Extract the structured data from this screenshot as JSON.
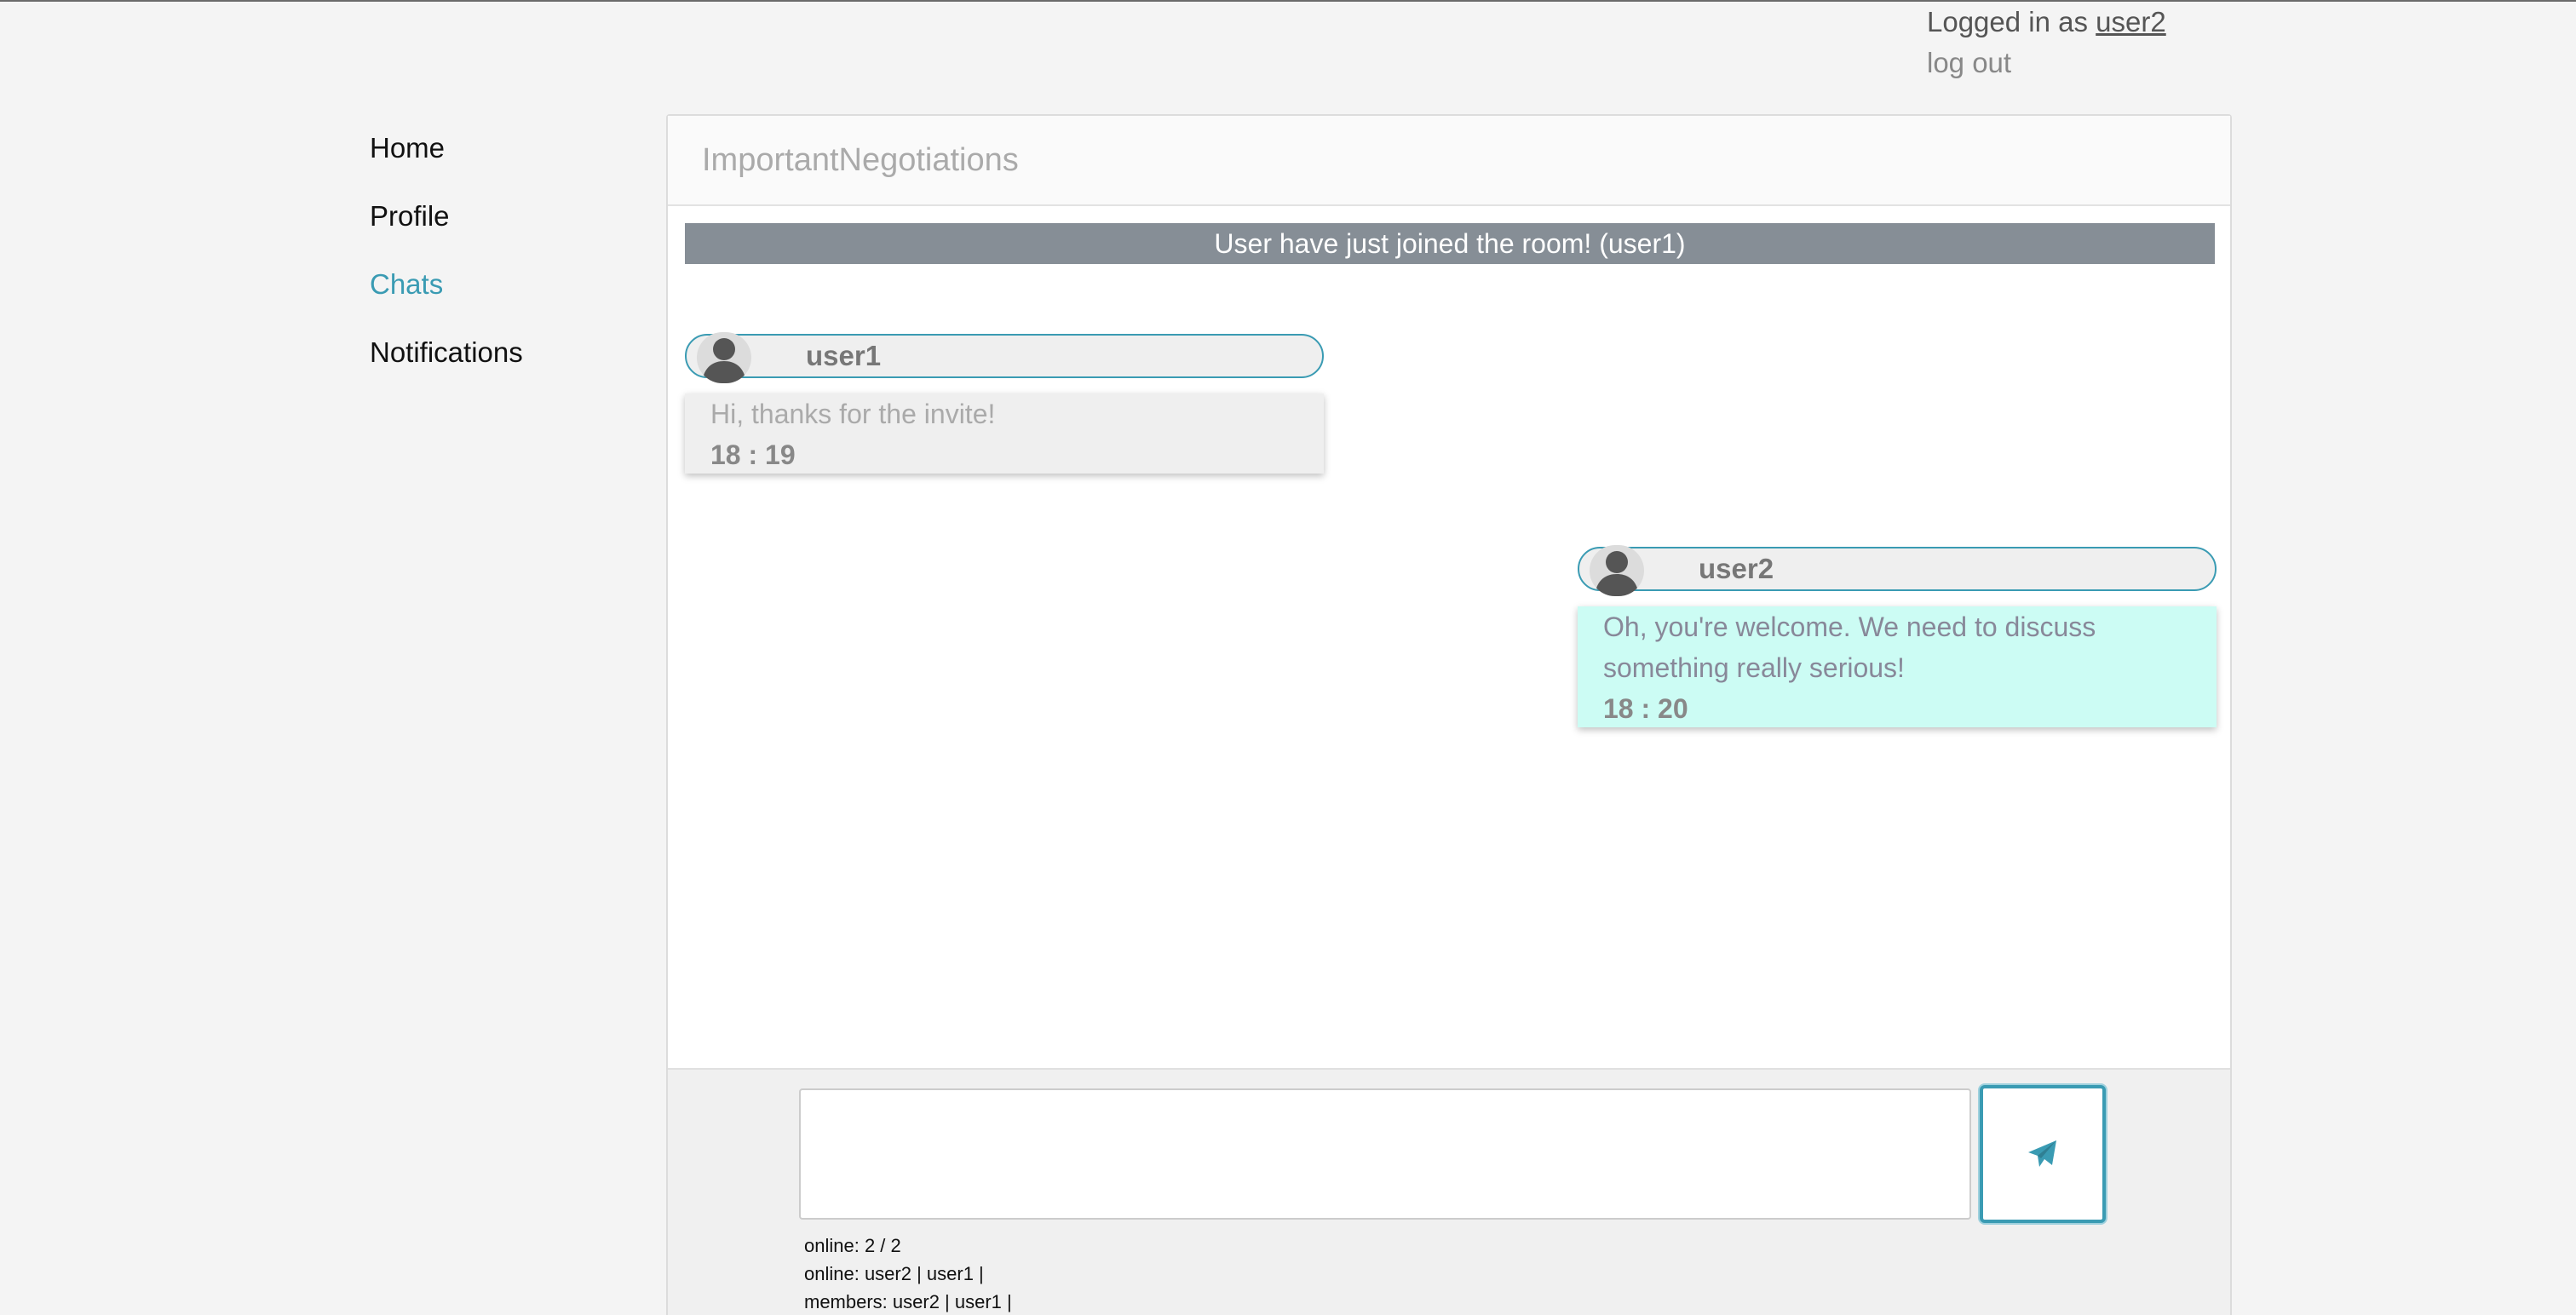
{
  "header": {
    "logged_in_prefix": "Logged in as",
    "username": "user2",
    "logout_label": "log out"
  },
  "sidebar": {
    "items": [
      {
        "label": "Home"
      },
      {
        "label": "Profile"
      },
      {
        "label": "Chats"
      },
      {
        "label": "Notifications"
      }
    ],
    "active": "Chats"
  },
  "chat": {
    "room_name": "ImportantNegotiations",
    "system_message": "User have just joined the room! (user1)",
    "messages": [
      {
        "author": "user1",
        "text": "Hi, thanks for the invite!",
        "time": "18 : 19"
      },
      {
        "author": "user2",
        "text": "Oh, you're welcome. We need to discuss something really serious!",
        "time": "18 : 20"
      }
    ]
  },
  "composer": {
    "message_value": "",
    "placeholder": "",
    "send_icon": "paper-plane-icon"
  },
  "status": {
    "online_count": "online: 2 / 2",
    "online_users": "online: user2 | user1 |",
    "members": "members: user2 | user1 |"
  },
  "colors": {
    "accent": "#3a9bb3",
    "system_bar": "#868e96",
    "own_message_bg": "#ccfcf4",
    "other_message_bg": "#efefef"
  }
}
